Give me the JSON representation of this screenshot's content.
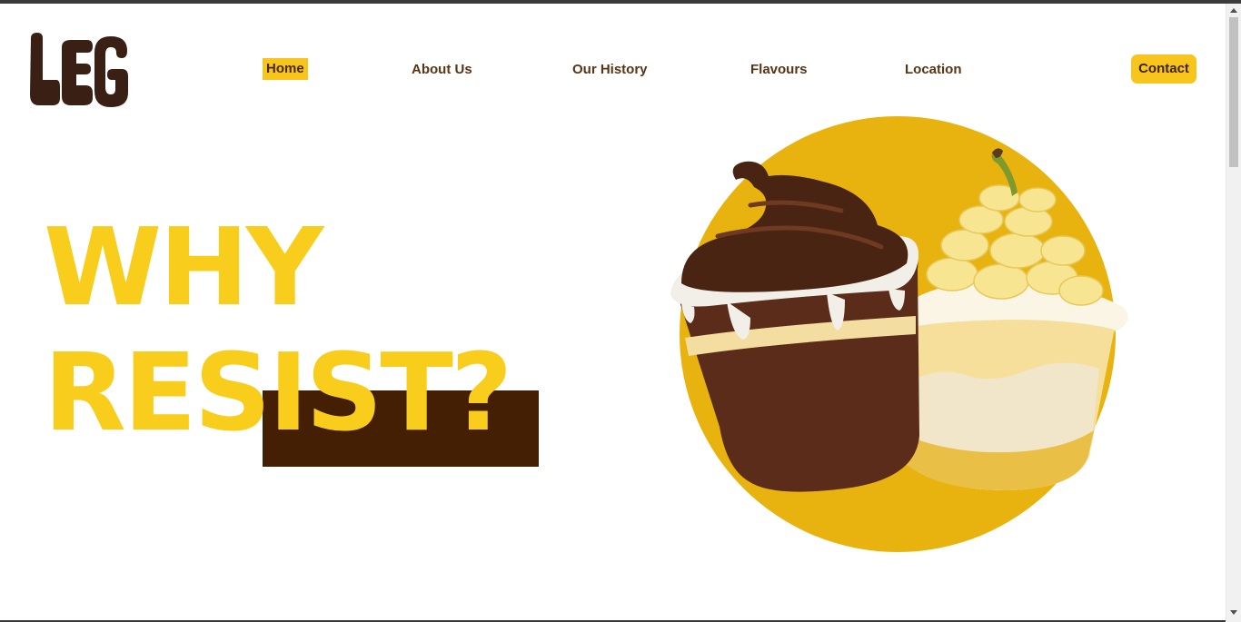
{
  "brand": {
    "logo_text": "LEG",
    "logo_icon": "leg-logo-icon"
  },
  "nav": {
    "items": [
      {
        "label": "Home",
        "active": true
      },
      {
        "label": "About Us",
        "active": false
      },
      {
        "label": "Our History",
        "active": false
      },
      {
        "label": "Flavours",
        "active": false
      },
      {
        "label": "Location",
        "active": false
      }
    ],
    "contact_label": "Contact"
  },
  "hero": {
    "line1": "WHY",
    "line2": "RESIST?",
    "illustration": "chocolate-and-banana-dessert-cups-icon"
  },
  "colors": {
    "accent_yellow": "#f9cd1c",
    "circle_yellow": "#e9b30f",
    "dark_brown": "#451f04",
    "nav_text": "#5a3312"
  }
}
